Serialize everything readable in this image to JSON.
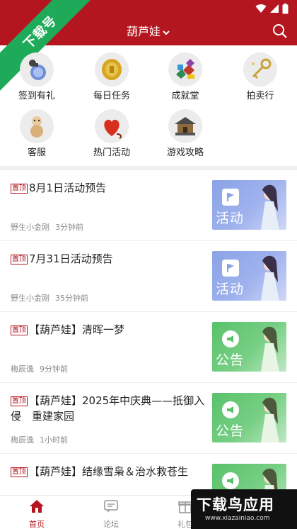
{
  "header": {
    "title": "葫芦娃"
  },
  "corner_banner": {
    "text": "下载号"
  },
  "grid": [
    {
      "label": "签到有礼",
      "icon": "potion-gourd-icon"
    },
    {
      "label": "每日任务",
      "icon": "gold-coin-icon"
    },
    {
      "label": "成就堂",
      "icon": "gem-pile-icon"
    },
    {
      "label": "拍卖行",
      "icon": "auction-key-icon"
    },
    {
      "label": "客服",
      "icon": "gourd-doll-icon"
    },
    {
      "label": "热门活动",
      "icon": "red-gourd-icon"
    },
    {
      "label": "游戏攻略",
      "icon": "pavilion-icon"
    }
  ],
  "news": [
    {
      "pin": "置顶",
      "title": "8月1日活动预告",
      "author": "野生小金刚",
      "time": "3分钟前",
      "tag": "活动"
    },
    {
      "pin": "置顶",
      "title": "7月31日活动预告",
      "author": "野生小金刚",
      "time": "35分钟前",
      "tag": "活动"
    },
    {
      "pin": "置顶",
      "title": "【葫芦娃】清晖一梦",
      "author": "梅辰逸",
      "time": "9分钟前",
      "tag": "公告"
    },
    {
      "pin": "置顶",
      "title": "【葫芦娃】2025年中庆典——抵御入侵　重建家园",
      "author": "梅辰逸",
      "time": "1小时前",
      "tag": "公告"
    },
    {
      "pin": "置顶",
      "title": "【葫芦娃】结缘雪枭＆治水救苍生",
      "author": "",
      "time": "",
      "tag": "公告"
    }
  ],
  "bottom_nav": [
    {
      "label": "首页",
      "icon": "home-icon",
      "active": true
    },
    {
      "label": "论坛",
      "icon": "forum-icon",
      "active": false
    },
    {
      "label": "礼包",
      "icon": "gift-icon",
      "active": false
    }
  ],
  "watermark": {
    "title": "下载鸟应用",
    "url": "www.xiazainiao.com"
  },
  "colors": {
    "brand": "#b3161e",
    "corner": "#1faa5a",
    "activity_thumb": "#8aa3e6",
    "notice_thumb": "#58c26a"
  }
}
